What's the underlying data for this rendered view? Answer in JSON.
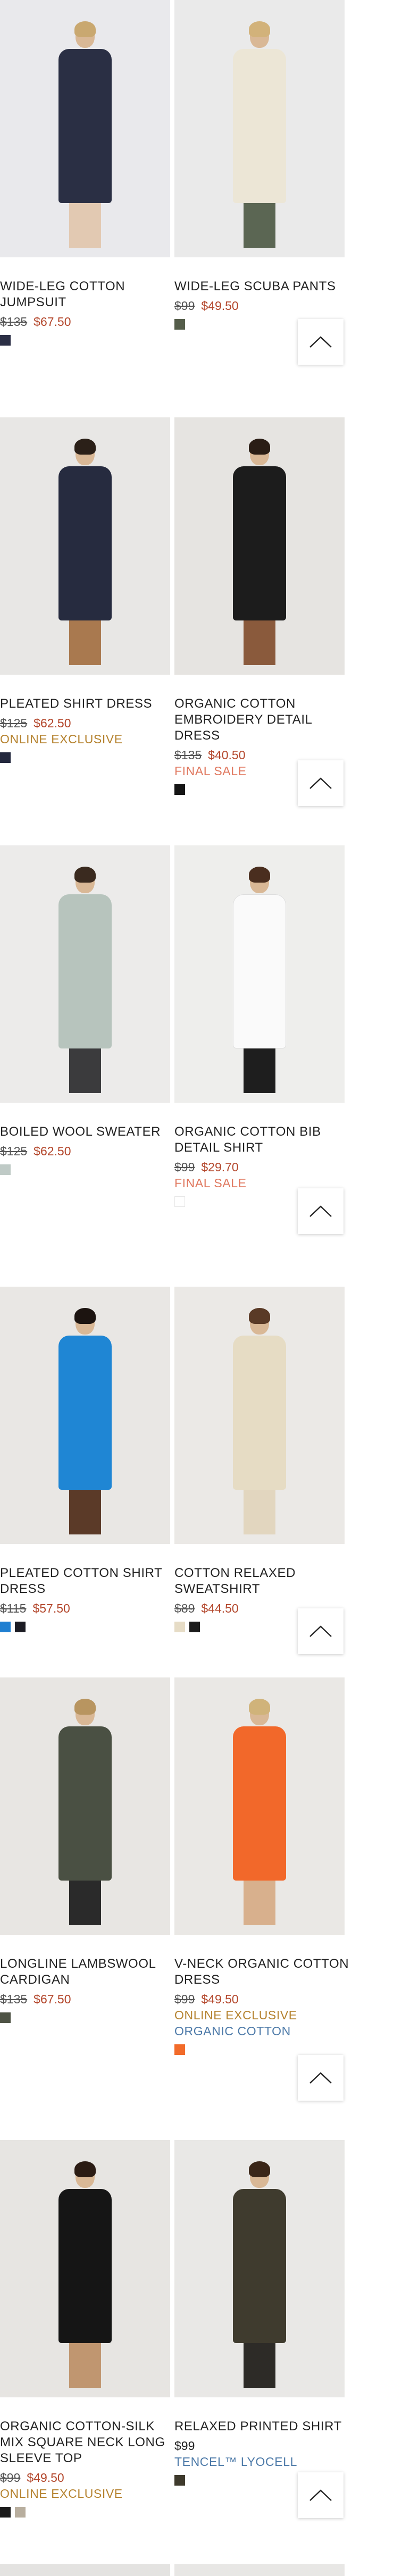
{
  "products": [
    {
      "name": "WIDE-LEG COTTON JUMPSUIT",
      "old_price": "$135",
      "new_price": "$67.50",
      "tags": [],
      "swatches": [
        "#2b2f45"
      ],
      "photo": {
        "bg": "#e9e9ec",
        "hair": "#c9a870",
        "garment": "#2a2f44",
        "legs": "#e2c9b2"
      }
    },
    {
      "name": "WIDE-LEG SCUBA PANTS",
      "old_price": "$99",
      "new_price": "$49.50",
      "tags": [],
      "swatches": [
        "#555d4a"
      ],
      "photo": {
        "bg": "#eaeaea",
        "hair": "#d2b27a",
        "garment": "#ece6d6",
        "legs": "#5b6653"
      }
    },
    {
      "name": "PLEATED SHIRT DRESS",
      "old_price": "$125",
      "new_price": "$62.50",
      "tags": [
        {
          "text": "ONLINE EXCLUSIVE",
          "kind": "exclusive"
        }
      ],
      "swatches": [
        "#23283d"
      ],
      "photo": {
        "bg": "#e8e7e5",
        "hair": "#2b2018",
        "garment": "#262b3f",
        "legs": "#a9794f"
      }
    },
    {
      "name": "ORGANIC COTTON EMBROIDERY DETAIL DRESS",
      "old_price": "$135",
      "new_price": "$40.50",
      "tags": [
        {
          "text": "FINAL SALE",
          "kind": "final"
        }
      ],
      "swatches": [
        "#151515"
      ],
      "photo": {
        "bg": "#e6e4e1",
        "hair": "#2a1d15",
        "garment": "#1c1c1c",
        "legs": "#8a5a3c"
      }
    },
    {
      "name": "BOILED WOOL SWEATER",
      "old_price": "$125",
      "new_price": "$62.50",
      "tags": [],
      "swatches": [
        "#bfcac6"
      ],
      "photo": {
        "bg": "#ecebea",
        "hair": "#3a2a1f",
        "garment": "#b7c4bd",
        "legs": "#3b3b3d"
      }
    },
    {
      "name": "ORGANIC COTTON BIB DETAIL SHIRT",
      "old_price": "$99",
      "new_price": "$29.70",
      "tags": [
        {
          "text": "FINAL SALE",
          "kind": "final"
        }
      ],
      "swatches": [
        "#ffffff"
      ],
      "photo": {
        "bg": "#eeeeec",
        "hair": "#4a2e1f",
        "garment": "#fafafa",
        "legs": "#1e1e1e"
      }
    },
    {
      "name": "PLEATED COTTON SHIRT DRESS",
      "old_price": "$115",
      "new_price": "$57.50",
      "tags": [],
      "swatches": [
        "#1f7fd1",
        "#1c1c24"
      ],
      "photo": {
        "bg": "#e9e7e4",
        "hair": "#1c1410",
        "garment": "#1f86d4",
        "legs": "#5b3a28"
      }
    },
    {
      "name": "COTTON RELAXED SWEATSHIRT",
      "old_price": "$89",
      "new_price": "$44.50",
      "tags": [],
      "swatches": [
        "#e6dcc6",
        "#1b1b1b"
      ],
      "photo": {
        "bg": "#ebe9e6",
        "hair": "#5a3a26",
        "garment": "#e6dcc4",
        "legs": "#e2d6bf"
      }
    },
    {
      "name": "LONGLINE LAMBSWOOL CARDIGAN",
      "old_price": "$135",
      "new_price": "$67.50",
      "tags": [],
      "swatches": [
        "#4e5345"
      ],
      "photo": {
        "bg": "#e8e6e3",
        "hair": "#b89560",
        "garment": "#4a5043",
        "legs": "#2a2a2a"
      }
    },
    {
      "name": "V-NECK ORGANIC COTTON DRESS",
      "old_price": "$99",
      "new_price": "$49.50",
      "tags": [
        {
          "text": "ONLINE EXCLUSIVE",
          "kind": "exclusive"
        },
        {
          "text": "ORGANIC COTTON",
          "kind": "material"
        }
      ],
      "swatches": [
        "#f26b2a"
      ],
      "photo": {
        "bg": "#eae8e5",
        "hair": "#d0b37a",
        "garment": "#f2682a",
        "legs": "#d8b08d"
      }
    },
    {
      "name": "ORGANIC COTTON-SILK MIX SQUARE NECK LONG SLEEVE TOP",
      "old_price": "$99",
      "new_price": "$49.50",
      "tags": [
        {
          "text": "ONLINE EXCLUSIVE",
          "kind": "exclusive"
        }
      ],
      "swatches": [
        "#1a1a1a",
        "#b8ae9e"
      ],
      "photo": {
        "bg": "#e7e5e2",
        "hair": "#2b1c14",
        "garment": "#151515",
        "legs": "#c09670"
      }
    },
    {
      "name": "RELAXED PRINTED SHIRT",
      "old_price": "",
      "new_price": "$99",
      "tags": [
        {
          "text": "TENCEL™ LYOCELL",
          "kind": "material"
        }
      ],
      "swatches": [
        "#3e3a2c"
      ],
      "photo": {
        "bg": "#e9e8e6",
        "hair": "#3a2618",
        "garment": "#3f3b2e",
        "legs": "#2d2b27"
      }
    }
  ],
  "back_to_top": {
    "icon": "chevron-up-icon"
  }
}
